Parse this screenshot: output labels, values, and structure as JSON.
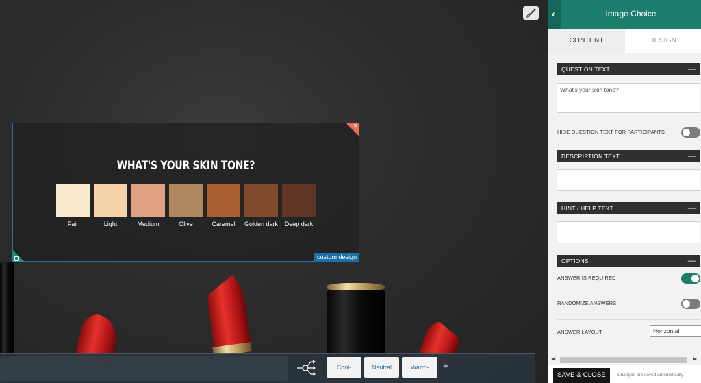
{
  "canvas": {
    "question": {
      "title": "WHAT'S YOUR SKIN TONE?",
      "badge": "custom design",
      "options": [
        {
          "label": "Fair",
          "color": "#fdebd0"
        },
        {
          "label": "Light",
          "color": "#f6d2aa"
        },
        {
          "label": "Medium",
          "color": "#dfa384"
        },
        {
          "label": "Olive",
          "color": "#ae8861"
        },
        {
          "label": "Caramel",
          "color": "#a85f32"
        },
        {
          "label": "Golden dark",
          "color": "#814b2b"
        },
        {
          "label": "Deep dark",
          "color": "#5f3525"
        }
      ]
    },
    "branches": [
      "Cool-toned",
      "Neutral",
      "Warm-toned"
    ],
    "add_branch": "+"
  },
  "panel": {
    "title": "Image Choice",
    "back": "‹",
    "tabs": {
      "content": "CONTENT",
      "design": "DESIGN"
    },
    "sections": {
      "question_text": "QUESTION TEXT",
      "description_text": "DESCRIPTION TEXT",
      "hint_text": "HINT / HELP TEXT",
      "options": "OPTIONS"
    },
    "collapse": "—",
    "question_value": "What's your skin tone?",
    "hide_question_label": "HIDE QUESTION TEXT FOR PARTICIPANTS",
    "answer_required_label": "ANSWER IS REQUIRED",
    "randomize_label": "RANDOMIZE ANSWERS",
    "answer_layout_label": "ANSWER LAYOUT",
    "answer_layout_value": "Horizontal",
    "toggles": {
      "hide_question": false,
      "answer_required": true,
      "randomize": false
    }
  },
  "footer": {
    "save_label": "SAVE & CLOSE",
    "autosave_note": "Changes are saved automatically"
  },
  "colors": {
    "accent": "#1c7e6d",
    "selection": "#2a6fa0",
    "lipstick": "#d62b25"
  }
}
